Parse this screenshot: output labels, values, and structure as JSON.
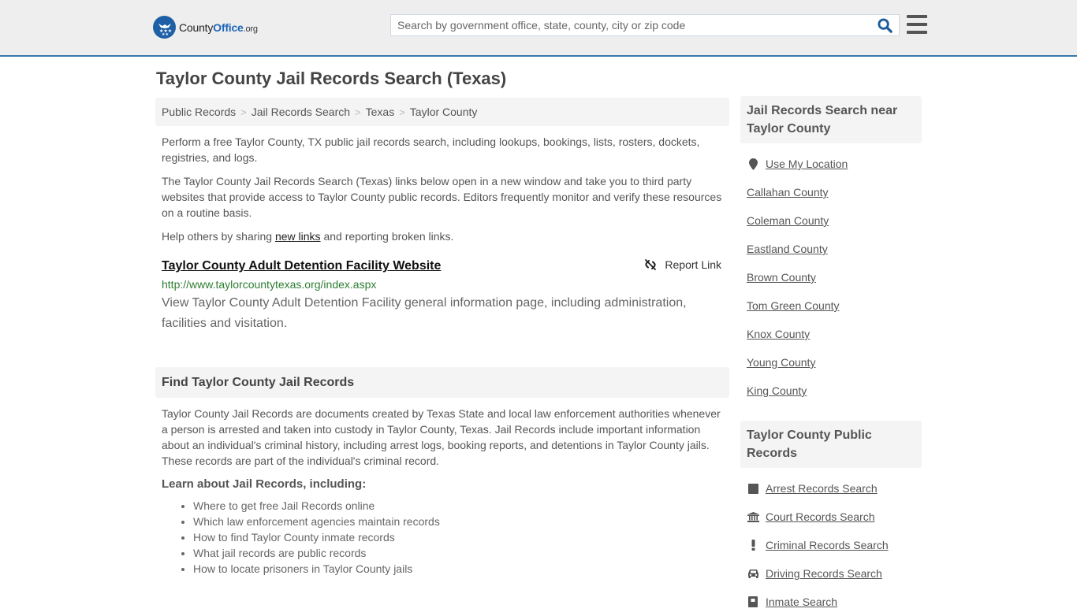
{
  "header": {
    "logo": {
      "text_main": "County",
      "text_brand": "Office",
      "text_tld": ".org"
    },
    "search": {
      "placeholder": "Search by government office, state, county, city or zip code",
      "value": ""
    },
    "search_icon": "search-icon",
    "menu_icon": "hamburger-menu-icon"
  },
  "page": {
    "title": "Taylor County Jail Records Search (Texas)"
  },
  "breadcrumb": [
    {
      "label": "Public Records"
    },
    {
      "label": "Jail Records Search"
    },
    {
      "label": "Texas"
    },
    {
      "label": "Taylor County"
    }
  ],
  "intro": {
    "p1": "Perform a free Taylor County, TX public jail records search, including lookups, bookings, lists, rosters, dockets, registries, and logs.",
    "p2": "The Taylor County Jail Records Search (Texas) links below open in a new window and take you to third party websites that provide access to Taylor County public records. Editors frequently monitor and verify these resources on a routine basis.",
    "p3_before": "Help others by sharing ",
    "p3_link": "new links",
    "p3_after": " and reporting broken links."
  },
  "resources": [
    {
      "title": "Taylor County Adult Detention Facility Website",
      "url": "http://www.taylorcountytexas.org/index.aspx",
      "description": "View Taylor County Adult Detention Facility general information page, including administration, facilities and visitation.",
      "report_label": "Report Link"
    }
  ],
  "find_section": {
    "heading": "Find Taylor County Jail Records",
    "body": "Taylor County Jail Records are documents created by Texas State and local law enforcement authorities whenever a person is arrested and taken into custody in Taylor County, Texas. Jail Records include important information about an individual's criminal history, including arrest logs, booking reports, and detentions in Taylor County jails. These records are part of the individual's criminal record.",
    "learn_heading": "Learn about Jail Records, including:",
    "learn_items": [
      "Where to get free Jail Records online",
      "Which law enforcement agencies maintain records",
      "How to find Taylor County inmate records",
      "What jail records are public records",
      "How to locate prisoners in Taylor County jails"
    ]
  },
  "sidebar": {
    "nearby": {
      "heading": "Jail Records Search near Taylor County",
      "use_location": "Use My Location",
      "counties": [
        "Callahan County",
        "Coleman County",
        "Eastland County",
        "Brown County",
        "Tom Green County",
        "Knox County",
        "Young County",
        "King County"
      ]
    },
    "public_records": {
      "heading": "Taylor County Public Records",
      "items": [
        {
          "label": "Arrest Records Search",
          "icon": "square-icon"
        },
        {
          "label": "Court Records Search",
          "icon": "courthouse-icon"
        },
        {
          "label": "Criminal Records Search",
          "icon": "exclamation-icon"
        },
        {
          "label": "Driving Records Search",
          "icon": "car-icon"
        },
        {
          "label": "Inmate Search",
          "icon": "inmate-icon"
        }
      ]
    }
  },
  "colors": {
    "header_bg": "#eeeeee",
    "header_border": "#3b78a9",
    "brand_blue": "#1f66b8",
    "url_green": "#2e7d32",
    "panel_bg": "#f4f4f4"
  }
}
